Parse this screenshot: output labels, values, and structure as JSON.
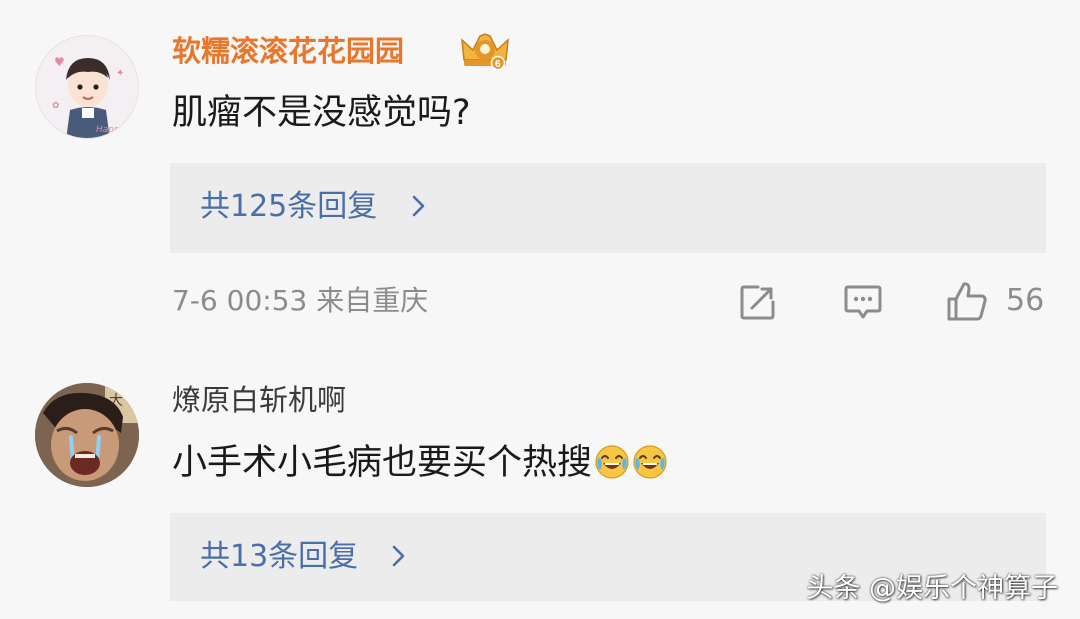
{
  "comments": [
    {
      "username": "软糯滚滚花花园园",
      "text": "肌瘤不是没感觉吗?",
      "reply_count_label": "共125条回复",
      "timestamp_location": "7-6 00:53 来自重庆",
      "like_count": "56",
      "username_color": "#e8772e",
      "badge_icon": "crown-badge-icon"
    },
    {
      "username": "燎原白斩机啊",
      "text": "小手术小毛病也要买个热搜",
      "emoji_icons": [
        "laugh-cry-emoji-icon",
        "laugh-cry-emoji-icon"
      ],
      "reply_count_label": "共13条回复"
    }
  ],
  "icons": {
    "share": "share-icon",
    "comment": "comment-icon",
    "like": "thumbs-up-icon",
    "reply_chevron": "chevron-right-icon"
  },
  "colors": {
    "reply_link": "#4a6ea8",
    "meta_text": "#8c8c8c",
    "reply_box_bg": "#ececec"
  },
  "watermark": "头条 @娱乐个神算子"
}
